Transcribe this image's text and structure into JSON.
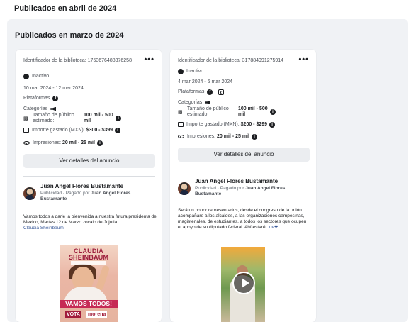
{
  "top_header": "Publicados en abril de 2024",
  "section_title": "Publicados en marzo de 2024",
  "cards": [
    {
      "library_id": "Identificador de la biblioteca: 1753676488376258",
      "status": "Inactivo",
      "dates": "10 mar 2024 - 12 mar 2024",
      "platforms_label": "Plataformas",
      "categories_label": "Categorías",
      "audience_label": "Tamaño de público estimado:",
      "audience_value": "100 mil - 500 mil",
      "spend_label": "Importe gastado (MXN):",
      "spend_value": "$300 - $399",
      "impressions_label": "Impresiones:",
      "impressions_value": "20 mil - 25 mil",
      "details_button": "Ver detalles del anuncio",
      "advertiser": "Juan Angel Flores Bustamante",
      "sponsor_prefix": "Publicidad · Pagado por",
      "sponsor_name": "Juan Angel Flores Bustamante",
      "body": "Vamos todos a darle la bienvenida a nuestra futura presidenta de Mexico, Martes 12 de Marzo zocalo de Jojutla.",
      "body_link": "Claudia Sheinbaum",
      "creative": {
        "headline": "CLAUDIA SHEINBAUM",
        "slogan": "VAMOS TODOS!",
        "vote": "VOTA",
        "party": "morena"
      }
    },
    {
      "library_id": "Identificador de la biblioteca: 317884991275914",
      "status": "Inactivo",
      "dates": "4 mar 2024 - 6 mar 2024",
      "platforms_label": "Plataformas",
      "categories_label": "Categorías",
      "audience_label": "Tamaño de público estimado:",
      "audience_value": "100 mil - 500 mil",
      "spend_label": "Importe gastado (MXN):",
      "spend_value": "$200 - $299",
      "impressions_label": "Impresiones:",
      "impressions_value": "20 mil - 25 mil",
      "details_button": "Ver detalles del anuncio",
      "advertiser": "Juan Angel Flores Bustamante",
      "sponsor_prefix": "Publicidad · Pagado por",
      "sponsor_name": "Juan Angel Flores Bustamante",
      "body": "Será un honor representarlos, desde el congreso de la unión acompañare a los alcaldes, a las organizaciones campesinas, magisteriales, de estudiantes, a todos los sectores que ocupen el apoyo de su diputado federal. Ahí estaré!. ",
      "body_link": "uv❤"
    }
  ],
  "colors": {
    "page_bg": "#f0f2f5",
    "card_bg": "#ffffff",
    "button_bg": "#ebedf0",
    "link": "#385898",
    "creative_accent": "#c62a55"
  },
  "icons": [
    "status-dot-icon",
    "facebook-icon",
    "instagram-icon",
    "megaphone-icon",
    "audience-icon",
    "money-icon",
    "eye-icon",
    "info-icon",
    "more-icon",
    "play-icon"
  ]
}
